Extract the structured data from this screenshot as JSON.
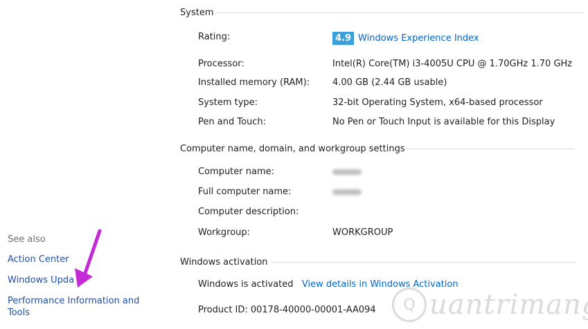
{
  "system": {
    "title": "System",
    "rating_label": "Rating:",
    "rating_score": "4.9",
    "rating_link": "Windows Experience Index",
    "rows": [
      {
        "label": "Processor:",
        "value": "Intel(R) Core(TM) i3-4005U CPU @ 1.70GHz   1.70 GHz"
      },
      {
        "label": "Installed memory (RAM):",
        "value": "4.00 GB (2.44 GB usable)"
      },
      {
        "label": "System type:",
        "value": "32-bit Operating System, x64-based processor"
      },
      {
        "label": "Pen and Touch:",
        "value": "No Pen or Touch Input is available for this Display"
      }
    ]
  },
  "computer": {
    "title": "Computer name, domain, and workgroup settings",
    "rows": [
      {
        "label": "Computer name:"
      },
      {
        "label": "Full computer name:"
      },
      {
        "label": "Computer description:",
        "value": ""
      },
      {
        "label": "Workgroup:",
        "value": "WORKGROUP"
      }
    ]
  },
  "activation": {
    "title": "Windows activation",
    "status": "Windows is activated",
    "link": "View details in Windows Activation",
    "product_id": "Product ID: 00178-40000-00001-AA094"
  },
  "sidebar": {
    "heading": "See also",
    "links": [
      "Action Center",
      "Windows Upda",
      "Performance Information and Tools"
    ]
  },
  "annotation": {
    "arrow_color": "#c42bd6",
    "arrow_icon": "arrow-pointing-icon"
  },
  "watermark": {
    "text": "uantrimang",
    "logo_letter": "Q"
  }
}
